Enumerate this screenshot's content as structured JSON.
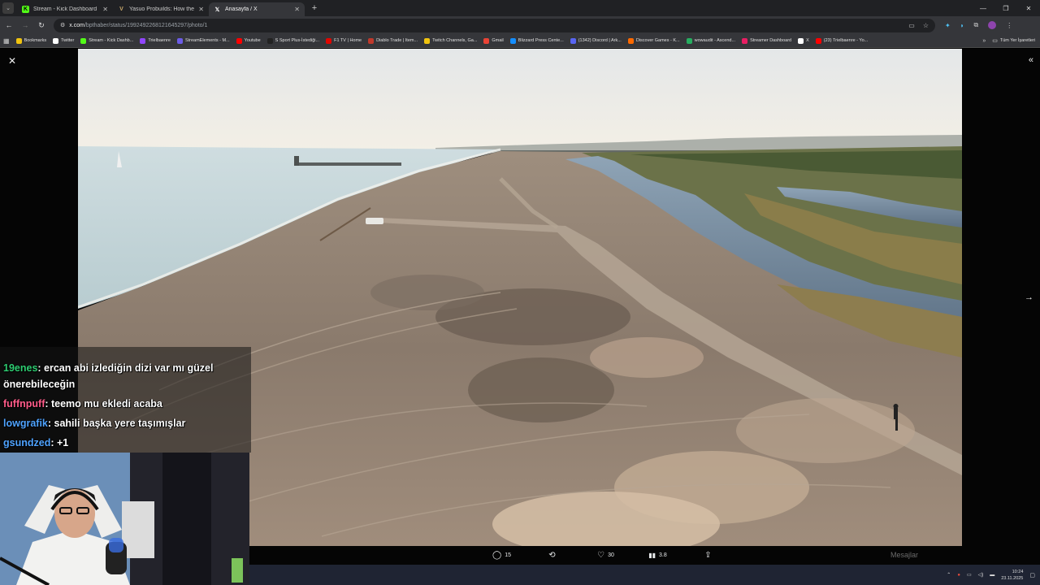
{
  "tabs": [
    {
      "title": "Stream - Kick Dashboard",
      "favicon": "kick-icon",
      "color": "#53fc18"
    },
    {
      "title": "Yasuo Probuilds: How the best",
      "favicon": "v-icon",
      "color": "#c8a86b"
    },
    {
      "title": "Anasayfa / X",
      "favicon": "x-icon",
      "color": "#ffffff",
      "active": true
    }
  ],
  "omnibox": {
    "host": "x.com",
    "path": "/bpthaber/status/1992492268121645297/photo/1"
  },
  "bookmarks": [
    {
      "label": "Bookmarks",
      "color": "#f1c40f"
    },
    {
      "label": "Twitter",
      "color": "#ffffff"
    },
    {
      "label": "Stream - Kick Dashb...",
      "color": "#53fc18"
    },
    {
      "label": "Trielbaenre",
      "color": "#9146ff"
    },
    {
      "label": "StreamElements - M...",
      "color": "#6c5ce7"
    },
    {
      "label": "Youtube",
      "color": "#ff0000"
    },
    {
      "label": "S Sport Plus-İstediği...",
      "color": "#222222"
    },
    {
      "label": "F1 TV | Home",
      "color": "#e10600"
    },
    {
      "label": "Diablo Trade | Item...",
      "color": "#c0392b"
    },
    {
      "label": "Twitch Channels, Ga...",
      "color": "#f1c40f"
    },
    {
      "label": "Gmail",
      "color": "#ea4335"
    },
    {
      "label": "Blizzard Press Cente...",
      "color": "#148eff"
    },
    {
      "label": "(1342) Discord | Ark...",
      "color": "#5865f2"
    },
    {
      "label": "Discover Games - K...",
      "color": "#ff6a00"
    },
    {
      "label": "wowaudit - Ascend...",
      "color": "#27ae60"
    },
    {
      "label": "Streamer Dashboard",
      "color": "#e91e63"
    },
    {
      "label": "X",
      "color": "#ffffff"
    },
    {
      "label": "(23) Trielbaenre - Yo...",
      "color": "#ff0000"
    }
  ],
  "bookmarks_more": "»",
  "bookmarks_all": "Tüm Yer İşaretleri",
  "actions": [
    {
      "icon": "reply-icon",
      "count": "15"
    },
    {
      "icon": "retweet-icon",
      "count": ""
    },
    {
      "icon": "like-icon",
      "count": "30"
    },
    {
      "icon": "views-icon",
      "count": "3.8"
    },
    {
      "icon": "share-icon",
      "count": ""
    }
  ],
  "messages_label": "Mesajlar",
  "chat": [
    {
      "user": "19enes",
      "color": "#2ecc71",
      "text": ": ercan abi izlediğin dizi var mı güzel"
    },
    {
      "user": "",
      "color": "#ffffff",
      "text": "önerebileceğin"
    },
    {
      "user": "fuffnpuff",
      "color": "#ff5c8a",
      "text": ": teemo mu ekledi acaba"
    },
    {
      "user": "lowgrafik",
      "color": "#4fa3ff",
      "text": ": sahili başka yere taşımışlar"
    },
    {
      "user": "gsundzed",
      "color": "#4fa3ff",
      "text": ": +1"
    }
  ],
  "clock": {
    "time": "10:24",
    "date": "23.11.2025"
  }
}
